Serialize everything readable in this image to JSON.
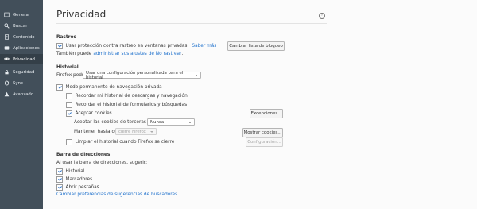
{
  "sidebar": {
    "items": [
      {
        "label": "General",
        "icon": "general-icon"
      },
      {
        "label": "Buscar",
        "icon": "search-icon"
      },
      {
        "label": "Contenido",
        "icon": "content-icon"
      },
      {
        "label": "Aplicaciones",
        "icon": "applications-icon"
      },
      {
        "label": "Privacidad",
        "icon": "privacy-mask-icon",
        "active": true
      },
      {
        "label": "Seguridad",
        "icon": "lock-icon"
      },
      {
        "label": "Sync",
        "icon": "sync-icon"
      },
      {
        "label": "Avanzado",
        "icon": "advanced-icon"
      }
    ]
  },
  "page": {
    "title": "Privacidad",
    "help_icon": "?"
  },
  "tracking": {
    "title": "Rastreo",
    "checkbox_label": "Usar protección contra rastreo en ventanas privadas",
    "learn_more": "Saber más",
    "change_blocklist_button": "Cambiar lista de bloqueo",
    "dnt_prefix": "También puede",
    "dnt_link": "administrar sus ajustes de No rastrear",
    "dnt_suffix": "."
  },
  "history": {
    "title": "Historial",
    "firefox_will_label": "Firefox podrá:",
    "firefox_will_value": "Usar una configuración personalizada para el historial",
    "private_mode": "Modo permanente de navegación privada",
    "remember_downloads": "Recordar mi historial de descargas y navegación",
    "remember_forms": "Recordar el historial de formularios y búsquedas",
    "accept_cookies": "Aceptar cookies",
    "exceptions_button": "Excepciones...",
    "third_party_label": "Aceptar las cookies de terceras partes:",
    "third_party_value": "Nunca",
    "keep_until_label": "Mantener hasta que:",
    "keep_until_value": "cierre Firefox",
    "show_cookies_button": "Mostrar cookies...",
    "clear_on_close": "Limpiar el historial cuando Firefox se cierre",
    "settings_button": "Configuración..."
  },
  "location_bar": {
    "title": "Barra de direcciones",
    "suggest_label": "Al usar la barra de direcciones, sugerir:",
    "history": "Historial",
    "bookmarks": "Marcadores",
    "open_tabs": "Abrir pestañas",
    "change_search_link": "Cambiar preferencias de sugerencias de buscadores..."
  },
  "colors": {
    "sidebar_bg": "#424f5a",
    "sidebar_active": "#343f48",
    "link": "#1f71cc",
    "checkmark": "#2e73c9"
  }
}
